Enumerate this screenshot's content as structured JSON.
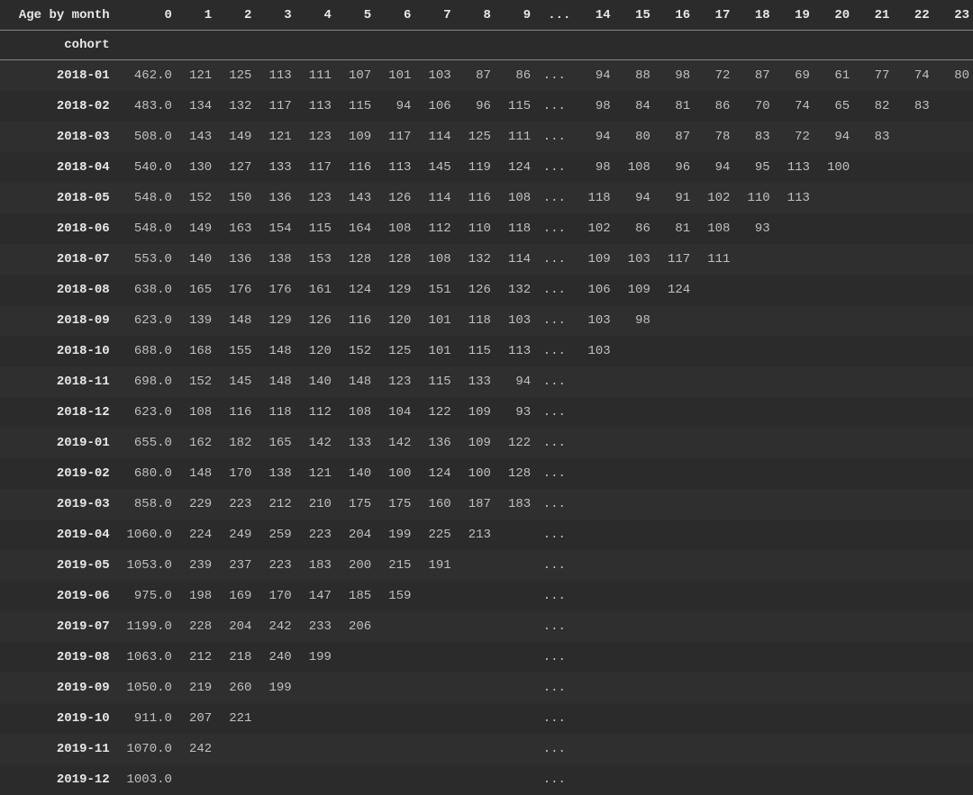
{
  "header": {
    "index_label_line1": "Age by month",
    "index_label_line2": "cohort",
    "columns_left": [
      "0",
      "1",
      "2",
      "3",
      "4",
      "5",
      "6",
      "7",
      "8",
      "9"
    ],
    "ellipsis": "...",
    "columns_right": [
      "14",
      "15",
      "16",
      "17",
      "18",
      "19",
      "20",
      "21",
      "22",
      "23"
    ]
  },
  "rows": [
    {
      "cohort": "2018-01",
      "left": [
        "462.0",
        "121",
        "125",
        "113",
        "111",
        "107",
        "101",
        "103",
        "87",
        "86"
      ],
      "right": [
        "94",
        "88",
        "98",
        "72",
        "87",
        "69",
        "61",
        "77",
        "74",
        "80"
      ]
    },
    {
      "cohort": "2018-02",
      "left": [
        "483.0",
        "134",
        "132",
        "117",
        "113",
        "115",
        "94",
        "106",
        "96",
        "115"
      ],
      "right": [
        "98",
        "84",
        "81",
        "86",
        "70",
        "74",
        "65",
        "82",
        "83",
        ""
      ]
    },
    {
      "cohort": "2018-03",
      "left": [
        "508.0",
        "143",
        "149",
        "121",
        "123",
        "109",
        "117",
        "114",
        "125",
        "111"
      ],
      "right": [
        "94",
        "80",
        "87",
        "78",
        "83",
        "72",
        "94",
        "83",
        "",
        ""
      ]
    },
    {
      "cohort": "2018-04",
      "left": [
        "540.0",
        "130",
        "127",
        "133",
        "117",
        "116",
        "113",
        "145",
        "119",
        "124"
      ],
      "right": [
        "98",
        "108",
        "96",
        "94",
        "95",
        "113",
        "100",
        "",
        "",
        ""
      ]
    },
    {
      "cohort": "2018-05",
      "left": [
        "548.0",
        "152",
        "150",
        "136",
        "123",
        "143",
        "126",
        "114",
        "116",
        "108"
      ],
      "right": [
        "118",
        "94",
        "91",
        "102",
        "110",
        "113",
        "",
        "",
        "",
        ""
      ]
    },
    {
      "cohort": "2018-06",
      "left": [
        "548.0",
        "149",
        "163",
        "154",
        "115",
        "164",
        "108",
        "112",
        "110",
        "118"
      ],
      "right": [
        "102",
        "86",
        "81",
        "108",
        "93",
        "",
        "",
        "",
        "",
        ""
      ]
    },
    {
      "cohort": "2018-07",
      "left": [
        "553.0",
        "140",
        "136",
        "138",
        "153",
        "128",
        "128",
        "108",
        "132",
        "114"
      ],
      "right": [
        "109",
        "103",
        "117",
        "111",
        "",
        "",
        "",
        "",
        "",
        ""
      ]
    },
    {
      "cohort": "2018-08",
      "left": [
        "638.0",
        "165",
        "176",
        "176",
        "161",
        "124",
        "129",
        "151",
        "126",
        "132"
      ],
      "right": [
        "106",
        "109",
        "124",
        "",
        "",
        "",
        "",
        "",
        "",
        ""
      ]
    },
    {
      "cohort": "2018-09",
      "left": [
        "623.0",
        "139",
        "148",
        "129",
        "126",
        "116",
        "120",
        "101",
        "118",
        "103"
      ],
      "right": [
        "103",
        "98",
        "",
        "",
        "",
        "",
        "",
        "",
        "",
        ""
      ]
    },
    {
      "cohort": "2018-10",
      "left": [
        "688.0",
        "168",
        "155",
        "148",
        "120",
        "152",
        "125",
        "101",
        "115",
        "113"
      ],
      "right": [
        "103",
        "",
        "",
        "",
        "",
        "",
        "",
        "",
        "",
        ""
      ]
    },
    {
      "cohort": "2018-11",
      "left": [
        "698.0",
        "152",
        "145",
        "148",
        "140",
        "148",
        "123",
        "115",
        "133",
        "94"
      ],
      "right": [
        "",
        "",
        "",
        "",
        "",
        "",
        "",
        "",
        "",
        ""
      ]
    },
    {
      "cohort": "2018-12",
      "left": [
        "623.0",
        "108",
        "116",
        "118",
        "112",
        "108",
        "104",
        "122",
        "109",
        "93"
      ],
      "right": [
        "",
        "",
        "",
        "",
        "",
        "",
        "",
        "",
        "",
        ""
      ]
    },
    {
      "cohort": "2019-01",
      "left": [
        "655.0",
        "162",
        "182",
        "165",
        "142",
        "133",
        "142",
        "136",
        "109",
        "122"
      ],
      "right": [
        "",
        "",
        "",
        "",
        "",
        "",
        "",
        "",
        "",
        ""
      ]
    },
    {
      "cohort": "2019-02",
      "left": [
        "680.0",
        "148",
        "170",
        "138",
        "121",
        "140",
        "100",
        "124",
        "100",
        "128"
      ],
      "right": [
        "",
        "",
        "",
        "",
        "",
        "",
        "",
        "",
        "",
        ""
      ]
    },
    {
      "cohort": "2019-03",
      "left": [
        "858.0",
        "229",
        "223",
        "212",
        "210",
        "175",
        "175",
        "160",
        "187",
        "183"
      ],
      "right": [
        "",
        "",
        "",
        "",
        "",
        "",
        "",
        "",
        "",
        ""
      ]
    },
    {
      "cohort": "2019-04",
      "left": [
        "1060.0",
        "224",
        "249",
        "259",
        "223",
        "204",
        "199",
        "225",
        "213",
        ""
      ],
      "right": [
        "",
        "",
        "",
        "",
        "",
        "",
        "",
        "",
        "",
        ""
      ]
    },
    {
      "cohort": "2019-05",
      "left": [
        "1053.0",
        "239",
        "237",
        "223",
        "183",
        "200",
        "215",
        "191",
        "",
        ""
      ],
      "right": [
        "",
        "",
        "",
        "",
        "",
        "",
        "",
        "",
        "",
        ""
      ]
    },
    {
      "cohort": "2019-06",
      "left": [
        "975.0",
        "198",
        "169",
        "170",
        "147",
        "185",
        "159",
        "",
        "",
        ""
      ],
      "right": [
        "",
        "",
        "",
        "",
        "",
        "",
        "",
        "",
        "",
        ""
      ]
    },
    {
      "cohort": "2019-07",
      "left": [
        "1199.0",
        "228",
        "204",
        "242",
        "233",
        "206",
        "",
        "",
        "",
        ""
      ],
      "right": [
        "",
        "",
        "",
        "",
        "",
        "",
        "",
        "",
        "",
        ""
      ]
    },
    {
      "cohort": "2019-08",
      "left": [
        "1063.0",
        "212",
        "218",
        "240",
        "199",
        "",
        "",
        "",
        "",
        ""
      ],
      "right": [
        "",
        "",
        "",
        "",
        "",
        "",
        "",
        "",
        "",
        ""
      ]
    },
    {
      "cohort": "2019-09",
      "left": [
        "1050.0",
        "219",
        "260",
        "199",
        "",
        "",
        "",
        "",
        "",
        ""
      ],
      "right": [
        "",
        "",
        "",
        "",
        "",
        "",
        "",
        "",
        "",
        ""
      ]
    },
    {
      "cohort": "2019-10",
      "left": [
        "911.0",
        "207",
        "221",
        "",
        "",
        "",
        "",
        "",
        "",
        ""
      ],
      "right": [
        "",
        "",
        "",
        "",
        "",
        "",
        "",
        "",
        "",
        ""
      ]
    },
    {
      "cohort": "2019-11",
      "left": [
        "1070.0",
        "242",
        "",
        "",
        "",
        "",
        "",
        "",
        "",
        ""
      ],
      "right": [
        "",
        "",
        "",
        "",
        "",
        "",
        "",
        "",
        "",
        ""
      ]
    },
    {
      "cohort": "2019-12",
      "left": [
        "1003.0",
        "",
        "",
        "",
        "",
        "",
        "",
        "",
        "",
        ""
      ],
      "right": [
        "",
        "",
        "",
        "",
        "",
        "",
        "",
        "",
        "",
        ""
      ]
    }
  ]
}
